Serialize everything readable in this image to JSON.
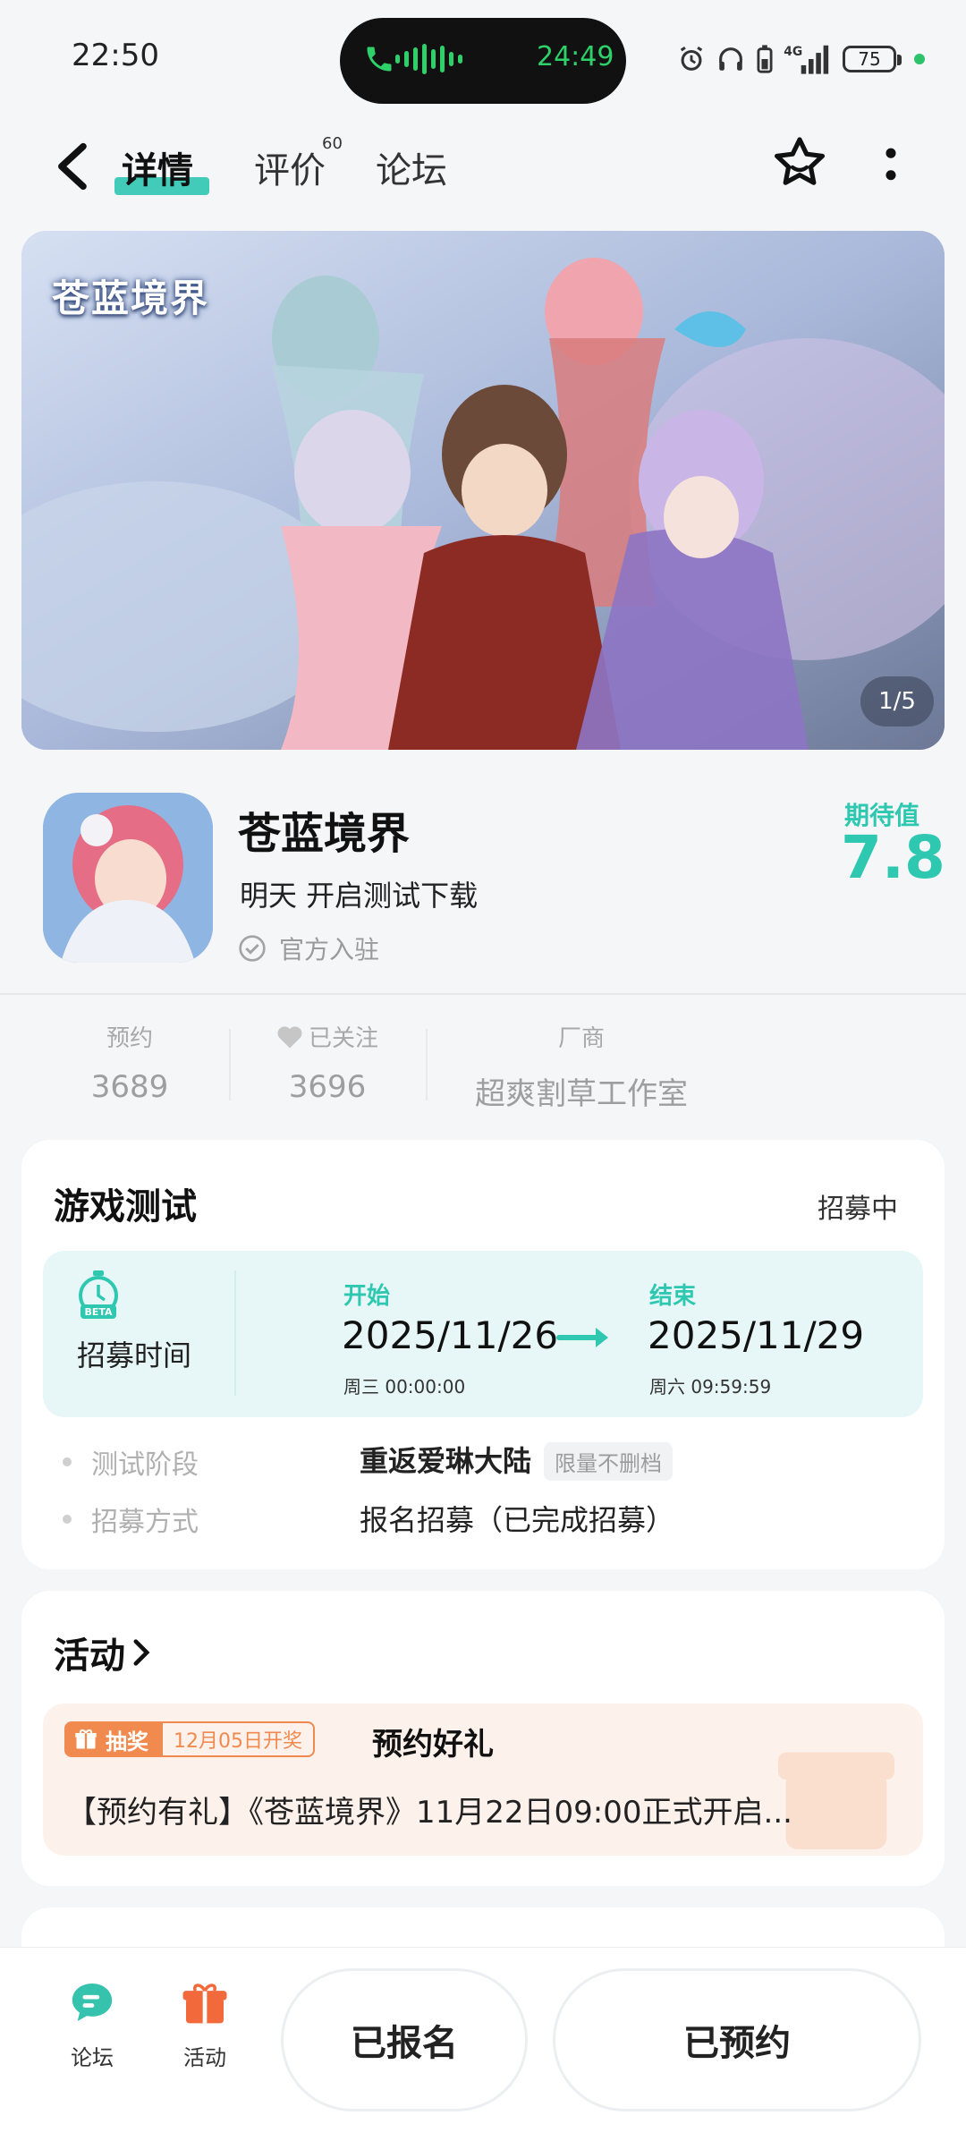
{
  "status_bar": {
    "time": "22:50",
    "call_timer": "24:49",
    "battery": "75",
    "network": "4G"
  },
  "header": {
    "tabs": [
      {
        "label": "详情",
        "active": true
      },
      {
        "label": "评价",
        "badge": "60"
      },
      {
        "label": "论坛"
      }
    ]
  },
  "banner": {
    "logo_text": "苍蓝境界",
    "counter": "1/5"
  },
  "app": {
    "name": "苍蓝境界",
    "subtitle": "明天 开启测试下载",
    "official_label": "官方入驻",
    "expect_label": "期待值",
    "expect_score": "7.8"
  },
  "stats": {
    "reservations_label": "预约",
    "reservations_value": "3689",
    "followers_label": "已关注",
    "followers_value": "3696",
    "developer_label": "厂商",
    "developer_value": "超爽割草工作室"
  },
  "game_test": {
    "title": "游戏测试",
    "status": "招募中",
    "recruit_time_label": "招募时间",
    "beta_text": "BETA",
    "start_label": "开始",
    "start_date": "2025/11/26",
    "start_time": "周三 00:00:00",
    "end_label": "结束",
    "end_date": "2025/11/29",
    "end_time": "周六 09:59:59",
    "stage_label": "测试阶段",
    "stage_value": "重返爱琳大陆",
    "stage_tag": "限量不删档",
    "method_label": "招募方式",
    "method_value": "报名招募（已完成招募）"
  },
  "activity": {
    "title": "活动",
    "tag_main": "抽奖",
    "tag_date": "12月05日开奖",
    "name": "预约好礼",
    "description": "【预约有礼】《苍蓝境界》11月22日09:00正式开启..."
  },
  "bottom_bar": {
    "forum_label": "论坛",
    "activity_label": "活动",
    "signed_up_label": "已报名",
    "reserved_label": "已预约"
  },
  "colors": {
    "accent": "#2ec7b0",
    "activity_orange": "#f08a4e",
    "background": "#f4f6f8"
  }
}
